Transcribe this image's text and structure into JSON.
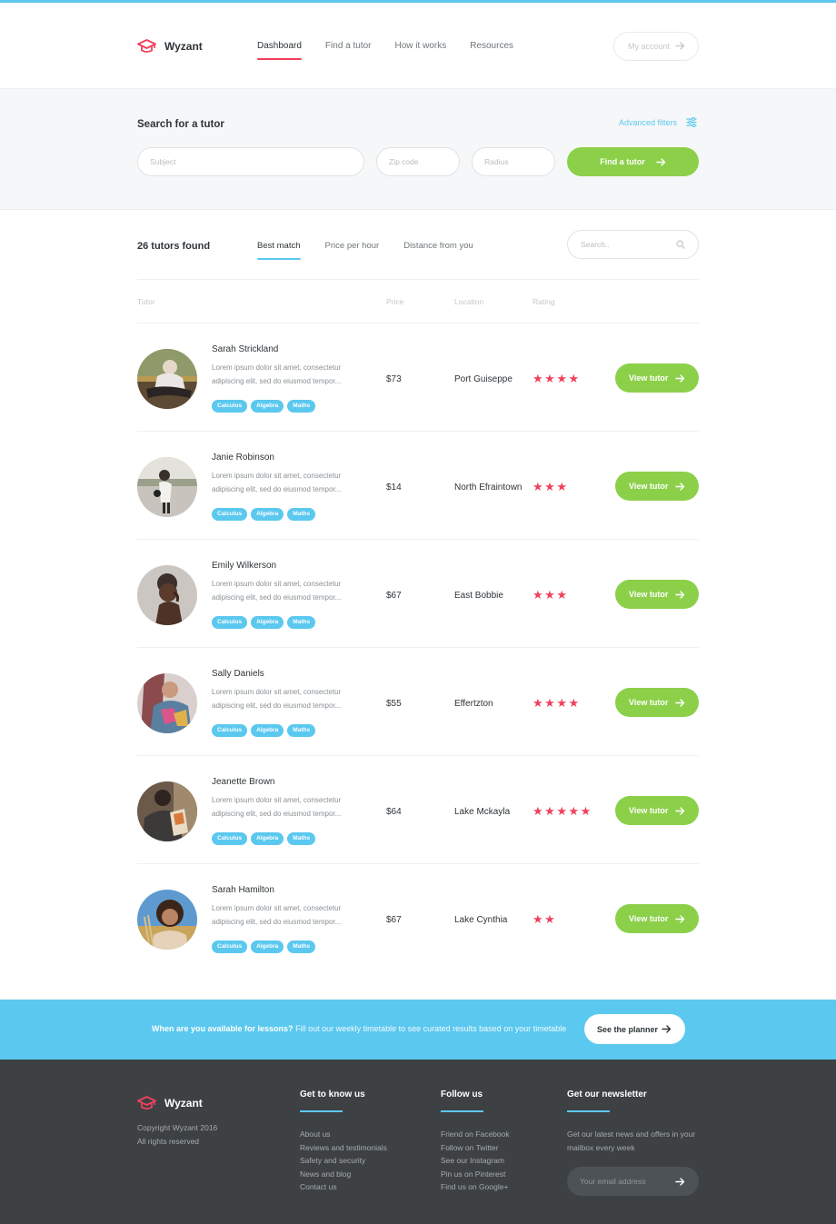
{
  "brand": {
    "name": "Wyzant"
  },
  "nav": {
    "items": [
      "Dashboard",
      "Find a tutor",
      "How it works",
      "Resources"
    ],
    "account_label": "My account"
  },
  "search": {
    "title": "Search for a tutor",
    "advanced_filters": "Advanced filters",
    "subject_placeholder": "Subject",
    "zip_placeholder": "Zip code",
    "radius_placeholder": "Radius",
    "find_button": "Find a tutor"
  },
  "results": {
    "count_label": "26 tutors found",
    "sort_tabs": [
      "Best match",
      "Price per hour",
      "Distance from you"
    ],
    "search_placeholder": "Search..",
    "columns": {
      "tutor": "Tutor",
      "price": "Price",
      "location": "Location",
      "rating": "Rating"
    },
    "view_button": "View tutor",
    "tutors": [
      {
        "name": "Sarah Strickland",
        "desc": "Lorem ipsum dolor sit amet, consectetur adipiscing elit, sed do eiusmod tempor...",
        "tags": [
          "Calculus",
          "Algebra",
          "Maths"
        ],
        "price": "$73",
        "location": "Port Guiseppe",
        "rating": 4
      },
      {
        "name": "Janie Robinson",
        "desc": "Lorem ipsum dolor sit amet, consectetur adipiscing elit, sed do eiusmod tempor...",
        "tags": [
          "Calculus",
          "Algebra",
          "Maths"
        ],
        "price": "$14",
        "location": "North Efraintown",
        "rating": 3
      },
      {
        "name": "Emily Wilkerson",
        "desc": "Lorem ipsum dolor sit amet, consectetur adipiscing elit, sed do eiusmod tempor...",
        "tags": [
          "Calculus",
          "Algebra",
          "Maths"
        ],
        "price": "$67",
        "location": "East Bobbie",
        "rating": 3
      },
      {
        "name": "Sally Daniels",
        "desc": "Lorem ipsum dolor sit amet, consectetur adipiscing elit, sed do eiusmod tempor...",
        "tags": [
          "Calculus",
          "Algebra",
          "Maths"
        ],
        "price": "$55",
        "location": "Effertzton",
        "rating": 4
      },
      {
        "name": "Jeanette Brown",
        "desc": "Lorem ipsum dolor sit amet, consectetur adipiscing elit, sed do eiusmod tempor...",
        "tags": [
          "Calculus",
          "Algebra",
          "Maths"
        ],
        "price": "$64",
        "location": "Lake Mckayla",
        "rating": 5
      },
      {
        "name": "Sarah Hamilton",
        "desc": "Lorem ipsum dolor sit amet, consectetur adipiscing elit, sed do eiusmod tempor...",
        "tags": [
          "Calculus",
          "Algebra",
          "Maths"
        ],
        "price": "$67",
        "location": "Lake Cynthia",
        "rating": 2
      }
    ]
  },
  "banner": {
    "question": "When are you available for lessons?",
    "text": "Fill out our weekly timetable to see curated results based on your timetable",
    "button": "See the planner"
  },
  "footer": {
    "copyright_line1": "Copyright Wyzant 2016",
    "copyright_line2": "All rights reserved",
    "col1_title": "Get to know us",
    "col1_links": [
      "About us",
      "Reviews and testimonials",
      "Safety and security",
      "News and blog",
      "Contact us"
    ],
    "col2_title": "Follow us",
    "col2_links": [
      "Friend on Facebook",
      "Follow on Twitter",
      "See our Instagram",
      "Pin us on Pinterest",
      "Find us on Google+"
    ],
    "col3_title": "Get our newsletter",
    "newsletter_desc": "Get our latest news and offers in your mailbox every week",
    "email_placeholder": "Your email address"
  },
  "colors": {
    "accent": "#5bc8ef",
    "primary_button": "#8cd04a",
    "brand_red": "#f0405c",
    "footer_bg": "#3d4144"
  },
  "icons": [
    "graduation-cap-icon",
    "arrow-right-icon",
    "sliders-icon",
    "search-icon",
    "star-icon"
  ]
}
